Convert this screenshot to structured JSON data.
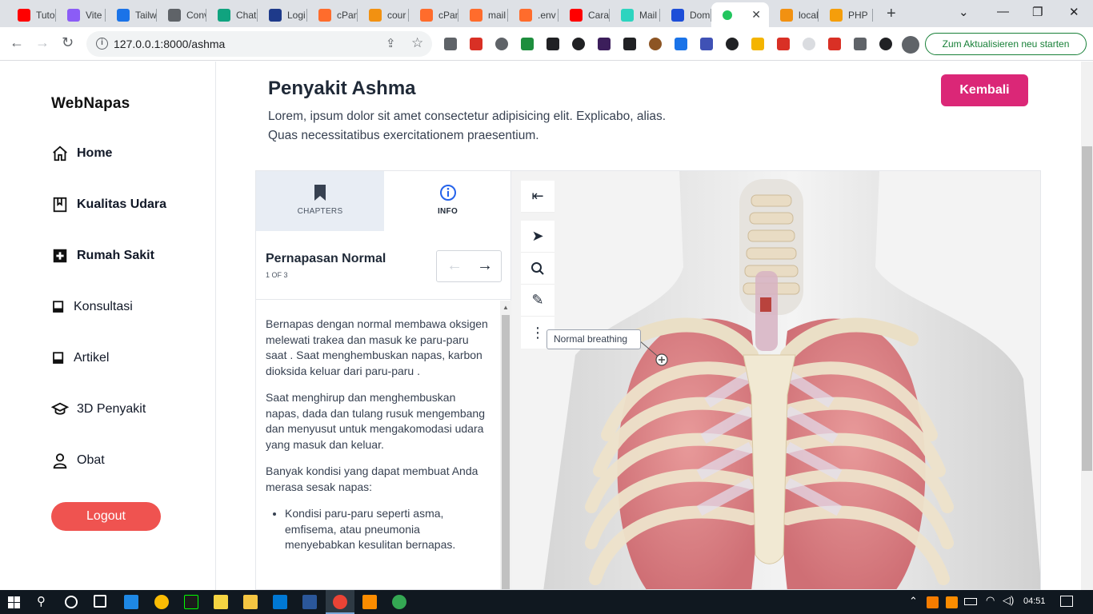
{
  "browser": {
    "tabs": [
      {
        "label": "Tuto",
        "icon": "youtube-icon",
        "color": "#ff0000"
      },
      {
        "label": "Vite",
        "icon": "vite-icon",
        "color": "#8b5cf6"
      },
      {
        "label": "Tailw",
        "icon": "play-icon",
        "color": "#1a73e8"
      },
      {
        "label": "Conv",
        "icon": "globe-icon",
        "color": "#5f6368"
      },
      {
        "label": "Chat",
        "icon": "chatgpt-icon",
        "color": "#10a37f"
      },
      {
        "label": "Logi",
        "icon": "n-logo-icon",
        "color": "#1e3a8a"
      },
      {
        "label": "cPan",
        "icon": "cpanel-icon",
        "color": "#ff6c2c"
      },
      {
        "label": "cour",
        "icon": "phpmyadmin-icon",
        "color": "#f29111"
      },
      {
        "label": "cPan",
        "icon": "cpanel-icon",
        "color": "#ff6c2c"
      },
      {
        "label": "mail",
        "icon": "cpanel-icon",
        "color": "#ff6c2c"
      },
      {
        "label": ".env",
        "icon": "cpanel-icon",
        "color": "#ff6c2c"
      },
      {
        "label": "Cara",
        "icon": "youtube-icon",
        "color": "#ff0000"
      },
      {
        "label": "Mail",
        "icon": "mail-icon",
        "color": "#2dd4bf"
      },
      {
        "label": "Dom",
        "icon": "domain-icon",
        "color": "#1d4ed8"
      },
      {
        "label": "",
        "icon": "loading-icon",
        "color": "#22c55e"
      },
      {
        "label": "local",
        "icon": "phpmyadmin-icon",
        "color": "#f29111"
      },
      {
        "label": "PHP",
        "icon": "php-icon",
        "color": "#f59e0b"
      }
    ],
    "url": "127.0.0.1:8000/ashma",
    "restart_label": "Zum Aktualisieren neu starten"
  },
  "sidebar": {
    "logo_pre": "Web",
    "logo_post": "Napas",
    "items": [
      {
        "label": "Home",
        "icon": "home-icon"
      },
      {
        "label": "Kualitas Udara",
        "icon": "book-icon"
      },
      {
        "label": "Rumah Sakit",
        "icon": "hospital-icon"
      },
      {
        "label": "Konsultasi",
        "icon": "book-open-icon"
      },
      {
        "label": "Artikel",
        "icon": "article-icon"
      },
      {
        "label": "3D Penyakit",
        "icon": "graduation-cap-icon"
      },
      {
        "label": "Obat",
        "icon": "user-icon"
      }
    ],
    "logout_label": "Logout"
  },
  "main": {
    "title": "Penyakit Ashma",
    "description_line1": "Lorem, ipsum dolor sit amet consectetur adipisicing elit. Explicabo, alias.",
    "description_line2": "Quas necessitatibus exercitationem praesentium.",
    "back_label": "Kembali"
  },
  "viewer": {
    "tabs": [
      {
        "label": "CHAPTERS",
        "icon": "bookmark-icon"
      },
      {
        "label": "INFO",
        "icon": "info-icon"
      }
    ],
    "chapter_title": "Pernapasan Normal",
    "chapter_count": "1 OF 3",
    "paragraphs": [
      "Bernapas dengan normal membawa oksigen  melewati trakea  dan masuk ke paru-paru saat . Saat  menghembuskan napas, karbon dioksida keluar dari paru-paru .",
      "Saat menghirup dan menghembuskan napas, dada dan tulang rusuk mengembang dan menyusut untuk mengakomodasi udara yang masuk dan keluar.",
      "Banyak kondisi yang dapat membuat Anda merasa sesak napas:"
    ],
    "list": [
      "Kondisi paru-paru seperti asma, emfisema, atau pneumonia menyebabkan kesulitan bernapas."
    ],
    "callout": "Normal breathing",
    "tools": [
      "collapse-panel-icon",
      "pointer-icon",
      "search-icon",
      "pencil-icon",
      "more-vertical-icon"
    ]
  },
  "taskbar": {
    "time": "04:51"
  }
}
